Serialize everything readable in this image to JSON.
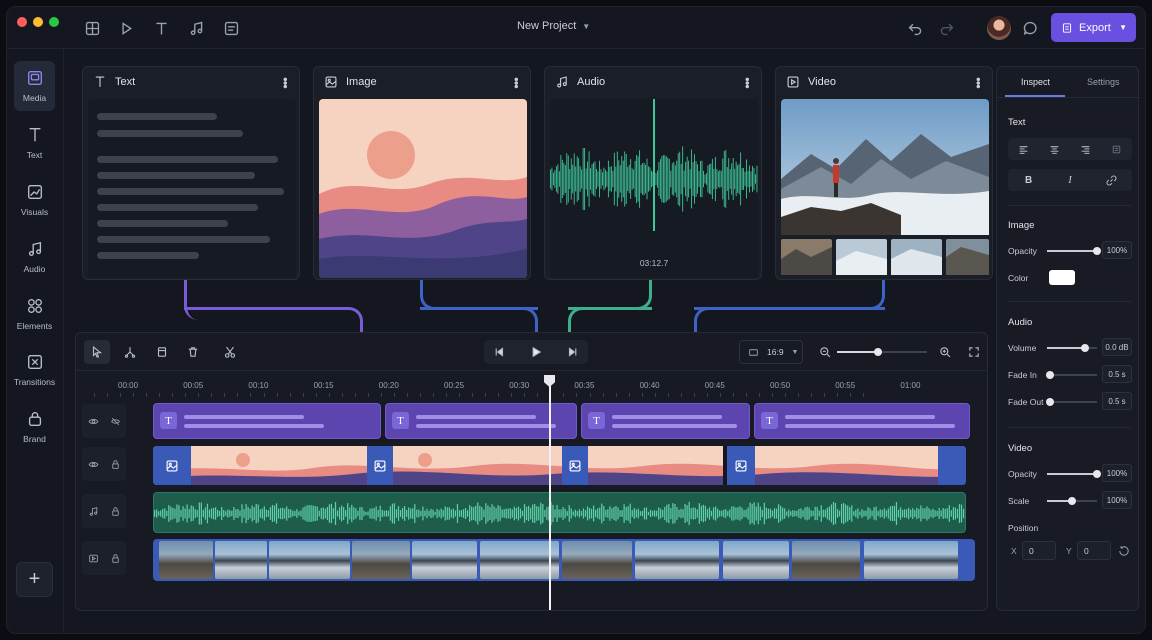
{
  "window": {
    "title": "New Project"
  },
  "toolbar": {
    "export_label": "Export"
  },
  "sidebar": {
    "items": [
      {
        "label": "Media",
        "icon": "media-icon"
      },
      {
        "label": "Text",
        "icon": "text-icon"
      },
      {
        "label": "Visuals",
        "icon": "visuals-icon"
      },
      {
        "label": "Audio",
        "icon": "music-note-icon"
      },
      {
        "label": "Elements",
        "icon": "elements-icon"
      },
      {
        "label": "Transitions",
        "icon": "transitions-icon"
      },
      {
        "label": "Brand",
        "icon": "brand-icon"
      }
    ]
  },
  "cards": [
    {
      "title": "Text",
      "icon": "text-icon"
    },
    {
      "title": "Image",
      "icon": "image-icon"
    },
    {
      "title": "Audio",
      "icon": "music-note-icon",
      "duration": "03:12.7"
    },
    {
      "title": "Video",
      "icon": "video-icon"
    }
  ],
  "timeline": {
    "aspect_ratio": "16:9",
    "zoom_level": 0.45,
    "ruler": [
      "00:00",
      "00:05",
      "00:10",
      "00:15",
      "00:20",
      "00:25",
      "00:30",
      "00:35",
      "00:40",
      "00:45",
      "00:50",
      "00:55",
      "01:00"
    ]
  },
  "inspector": {
    "tabs": [
      "Inspect",
      "Settings"
    ],
    "text": {
      "title": "Text"
    },
    "image": {
      "title": "Image",
      "opacity_label": "Opacity",
      "opacity_value": "100%",
      "opacity_level": 1.0,
      "color_label": "Color",
      "color": "#ffffff"
    },
    "audio": {
      "title": "Audio",
      "volume_label": "Volume",
      "volume_value": "0.0 dB",
      "volume_level": 0.75,
      "fade_in_label": "Fade In",
      "fade_in_value": "0.5 s",
      "fade_out_label": "Fade Out",
      "fade_out_value": "0.5 s"
    },
    "video": {
      "title": "Video",
      "opacity_label": "Opacity",
      "opacity_value": "100%",
      "opacity_level": 1.0,
      "scale_label": "Scale",
      "scale_value": "100%",
      "scale_level": 0.5,
      "position_label": "Position",
      "x_label": "X",
      "x_value": "0",
      "y_label": "Y",
      "y_value": "0"
    }
  },
  "colors": {
    "accent": "#6a4fe0",
    "text_clip": "#5d45b0",
    "image_clip": "#3a5ab8",
    "audio_wave": "#3fc79a"
  }
}
